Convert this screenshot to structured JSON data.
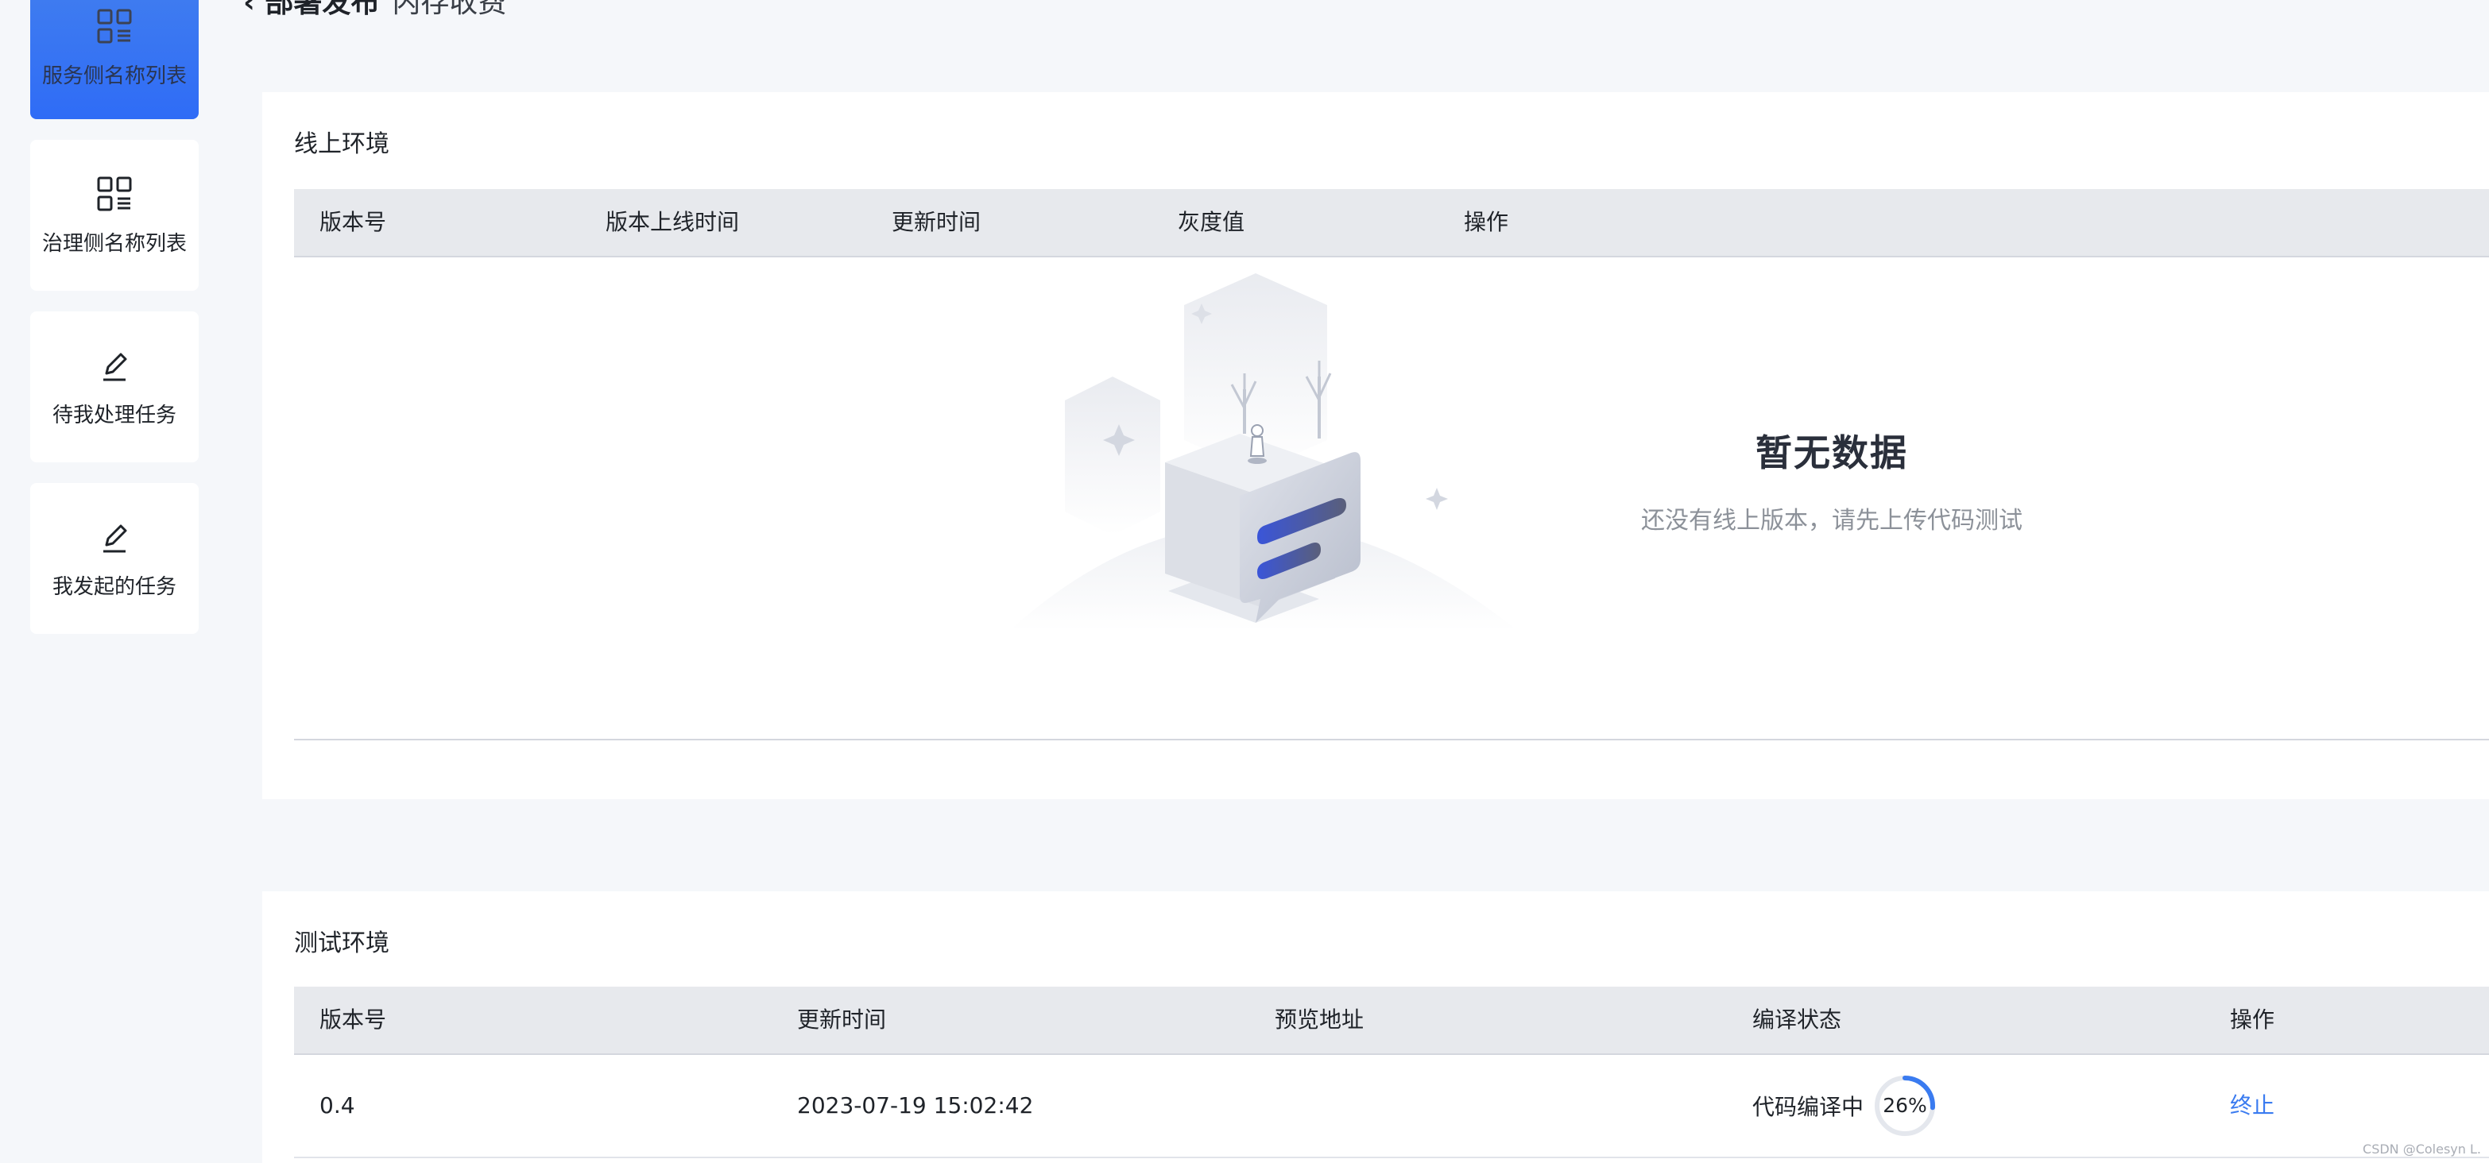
{
  "header": {
    "title": "部署发布",
    "subtitle": "内存收费"
  },
  "sidebar": {
    "items": [
      {
        "label": "服务侧名称列表",
        "icon": "grid-list-icon",
        "active": true
      },
      {
        "label": "治理侧名称列表",
        "icon": "grid-list-icon",
        "active": false
      },
      {
        "label": "待我处理任务",
        "icon": "edit-pen-icon",
        "active": false
      },
      {
        "label": "我发起的任务",
        "icon": "edit-pen-icon",
        "active": false
      }
    ]
  },
  "online": {
    "title": "线上环境",
    "columns": [
      "版本号",
      "版本上线时间",
      "更新时间",
      "灰度值",
      "操作"
    ],
    "empty": {
      "title": "暂无数据",
      "description": "还没有线上版本，请先上传代码测试"
    }
  },
  "test": {
    "title": "测试环境",
    "columns": [
      "版本号",
      "更新时间",
      "预览地址",
      "编译状态",
      "操作"
    ],
    "rows": [
      {
        "version": "0.4",
        "updated": "2023-07-19 15:02:42",
        "preview": "",
        "status": "代码编译中",
        "progress": 26,
        "progress_label": "26%",
        "action": "终止"
      }
    ]
  },
  "colors": {
    "accent": "#3a7bf0",
    "sidebar_active": "#2f6cf6",
    "table_header": "#e7e9ed",
    "page_bg": "#f5f7fa"
  },
  "watermark": "CSDN @Colesyn L."
}
